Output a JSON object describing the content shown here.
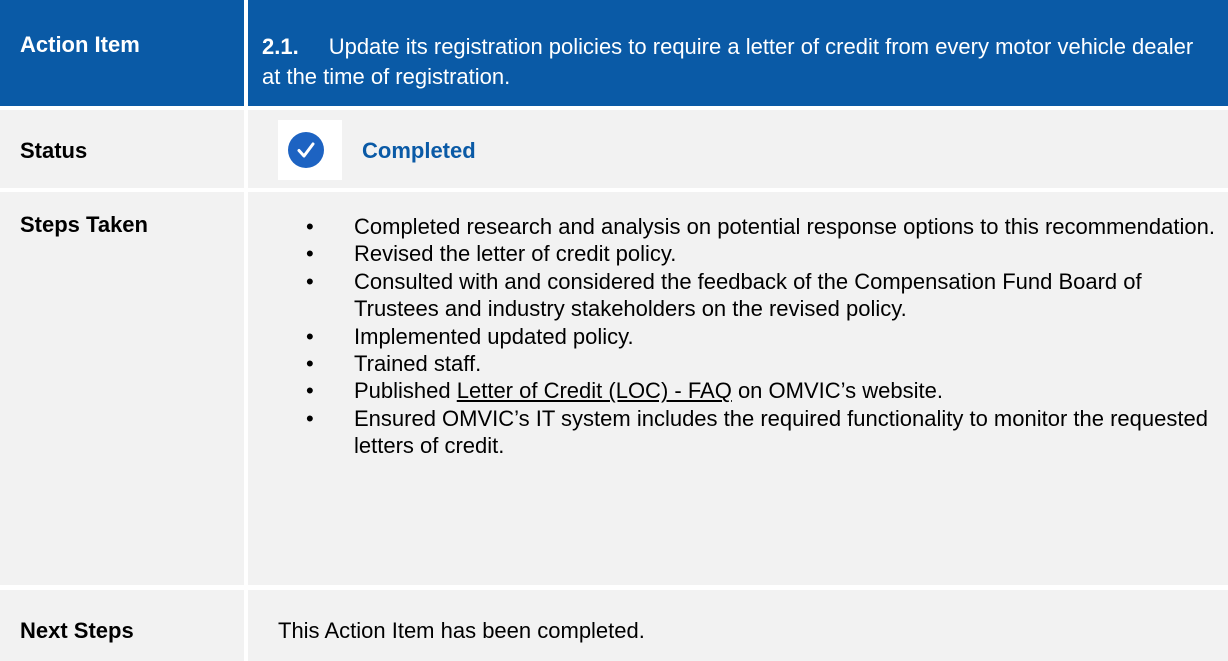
{
  "action_item": {
    "label": "Action Item",
    "number": "2.1.",
    "text": "Update its registration policies to require a letter of credit from every motor vehicle dealer at the time of registration."
  },
  "status": {
    "label": "Status",
    "value": "Completed",
    "icon": "check-circle-icon",
    "icon_color": "#1d63c2"
  },
  "steps_taken": {
    "label": "Steps Taken",
    "items": [
      {
        "text": "Completed research and analysis on potential response options to this recommendation."
      },
      {
        "text": "Revised the letter of credit policy."
      },
      {
        "text": "Consulted with and considered the feedback of the Compensation Fund Board of Trustees and industry stakeholders on the revised policy."
      },
      {
        "text": "Implemented updated policy."
      },
      {
        "text": "Trained staff."
      },
      {
        "pre": "Published ",
        "link": "Letter of Credit (LOC) - FAQ",
        "post": " on OMVIC’s website."
      },
      {
        "text": "Ensured OMVIC’s IT system includes the required functionality to monitor the requested letters of credit."
      }
    ]
  },
  "next_steps": {
    "label": "Next Steps",
    "value": "This Action Item has been completed."
  },
  "colors": {
    "header_bg": "#0a5aa6",
    "row_bg": "#f2f2f2",
    "status_text": "#0a5aa6"
  }
}
